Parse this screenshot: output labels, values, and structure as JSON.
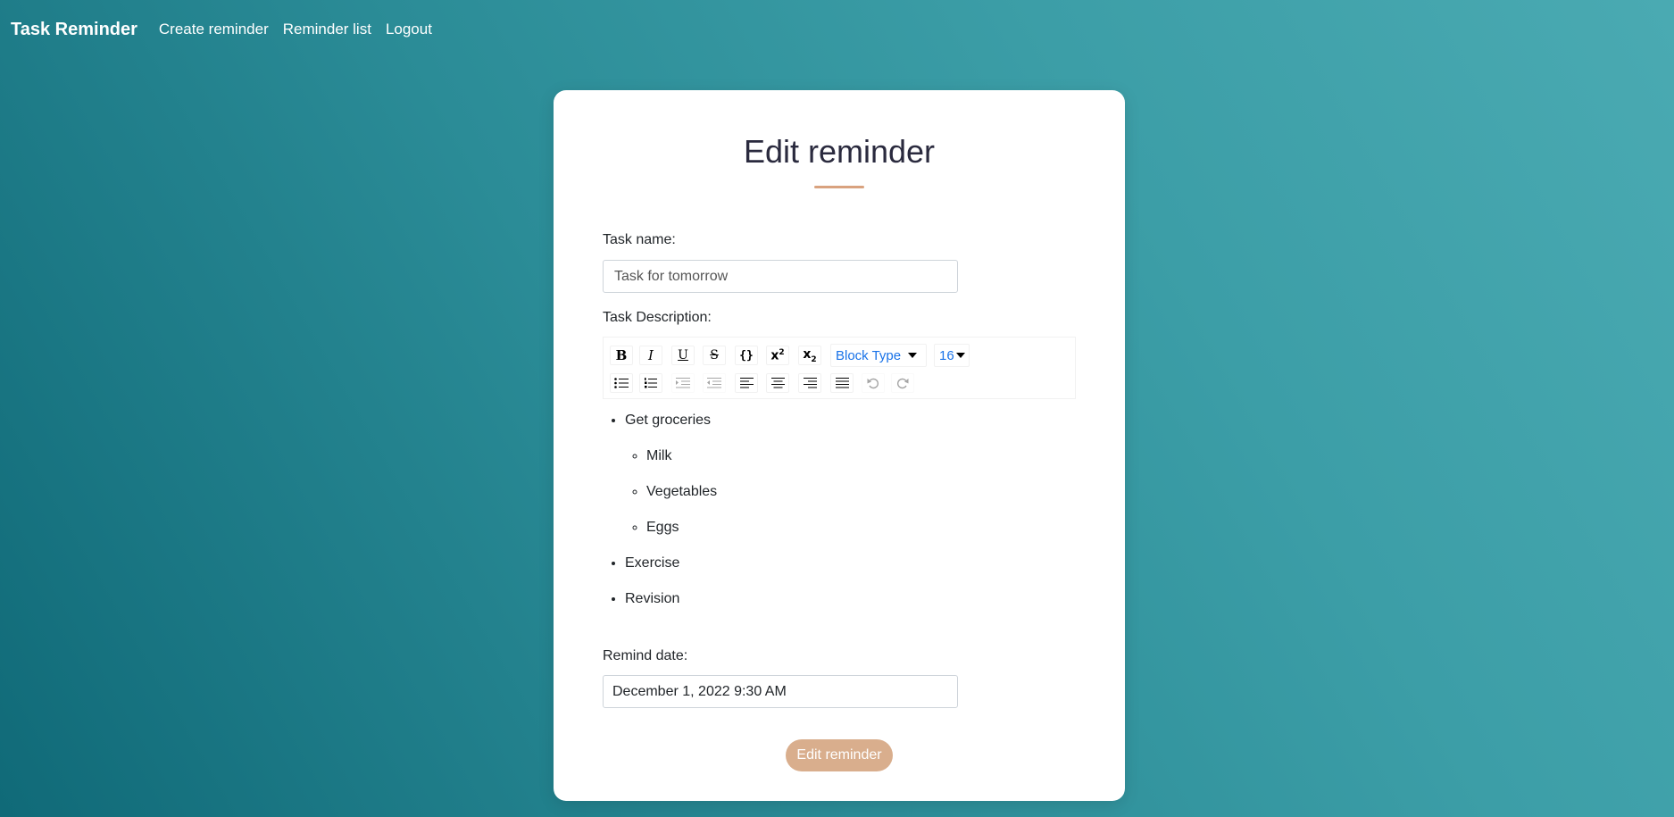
{
  "nav": {
    "brand": "Task Reminder",
    "links": [
      "Create reminder",
      "Reminder list",
      "Logout"
    ]
  },
  "form": {
    "title": "Edit reminder",
    "task_name_label": "Task name:",
    "task_name_value": "Task for tomorrow",
    "description_label": "Task Description:",
    "remind_date_label": "Remind date:",
    "remind_date_value": "December 1, 2022 9:30 AM",
    "submit_label": "Edit reminder"
  },
  "toolbar": {
    "block_type": "Block Type",
    "font_size": "16",
    "link_color": "#1a73e8"
  },
  "description": {
    "items": [
      {
        "text": "Get groceries",
        "children": [
          "Milk",
          "Vegetables",
          "Eggs"
        ]
      },
      {
        "text": "Exercise",
        "children": []
      },
      {
        "text": "Revision",
        "children": []
      }
    ]
  },
  "colors": {
    "accent": "#d9ae8d",
    "underline": "#d9a27f",
    "bg_start": "#106a78",
    "bg_end": "#4aaab2"
  }
}
